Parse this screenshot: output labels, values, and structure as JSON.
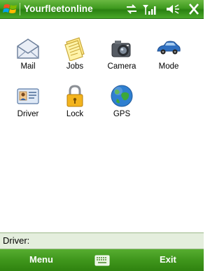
{
  "titlebar": {
    "title": "Yourfleetonline"
  },
  "apps": [
    {
      "label": "Mail",
      "icon": "mail-icon"
    },
    {
      "label": "Jobs",
      "icon": "jobs-icon"
    },
    {
      "label": "Camera",
      "icon": "camera-icon"
    },
    {
      "label": "Mode",
      "icon": "car-icon"
    },
    {
      "label": "Driver",
      "icon": "id-card-icon"
    },
    {
      "label": "Lock",
      "icon": "lock-icon"
    },
    {
      "label": "GPS",
      "icon": "globe-icon"
    }
  ],
  "status": {
    "driver_label": "Driver:"
  },
  "softkeys": {
    "left": "Menu",
    "right": "Exit"
  },
  "colors": {
    "accent": "#3f9a1f",
    "status_bar": "#e4eedd"
  }
}
